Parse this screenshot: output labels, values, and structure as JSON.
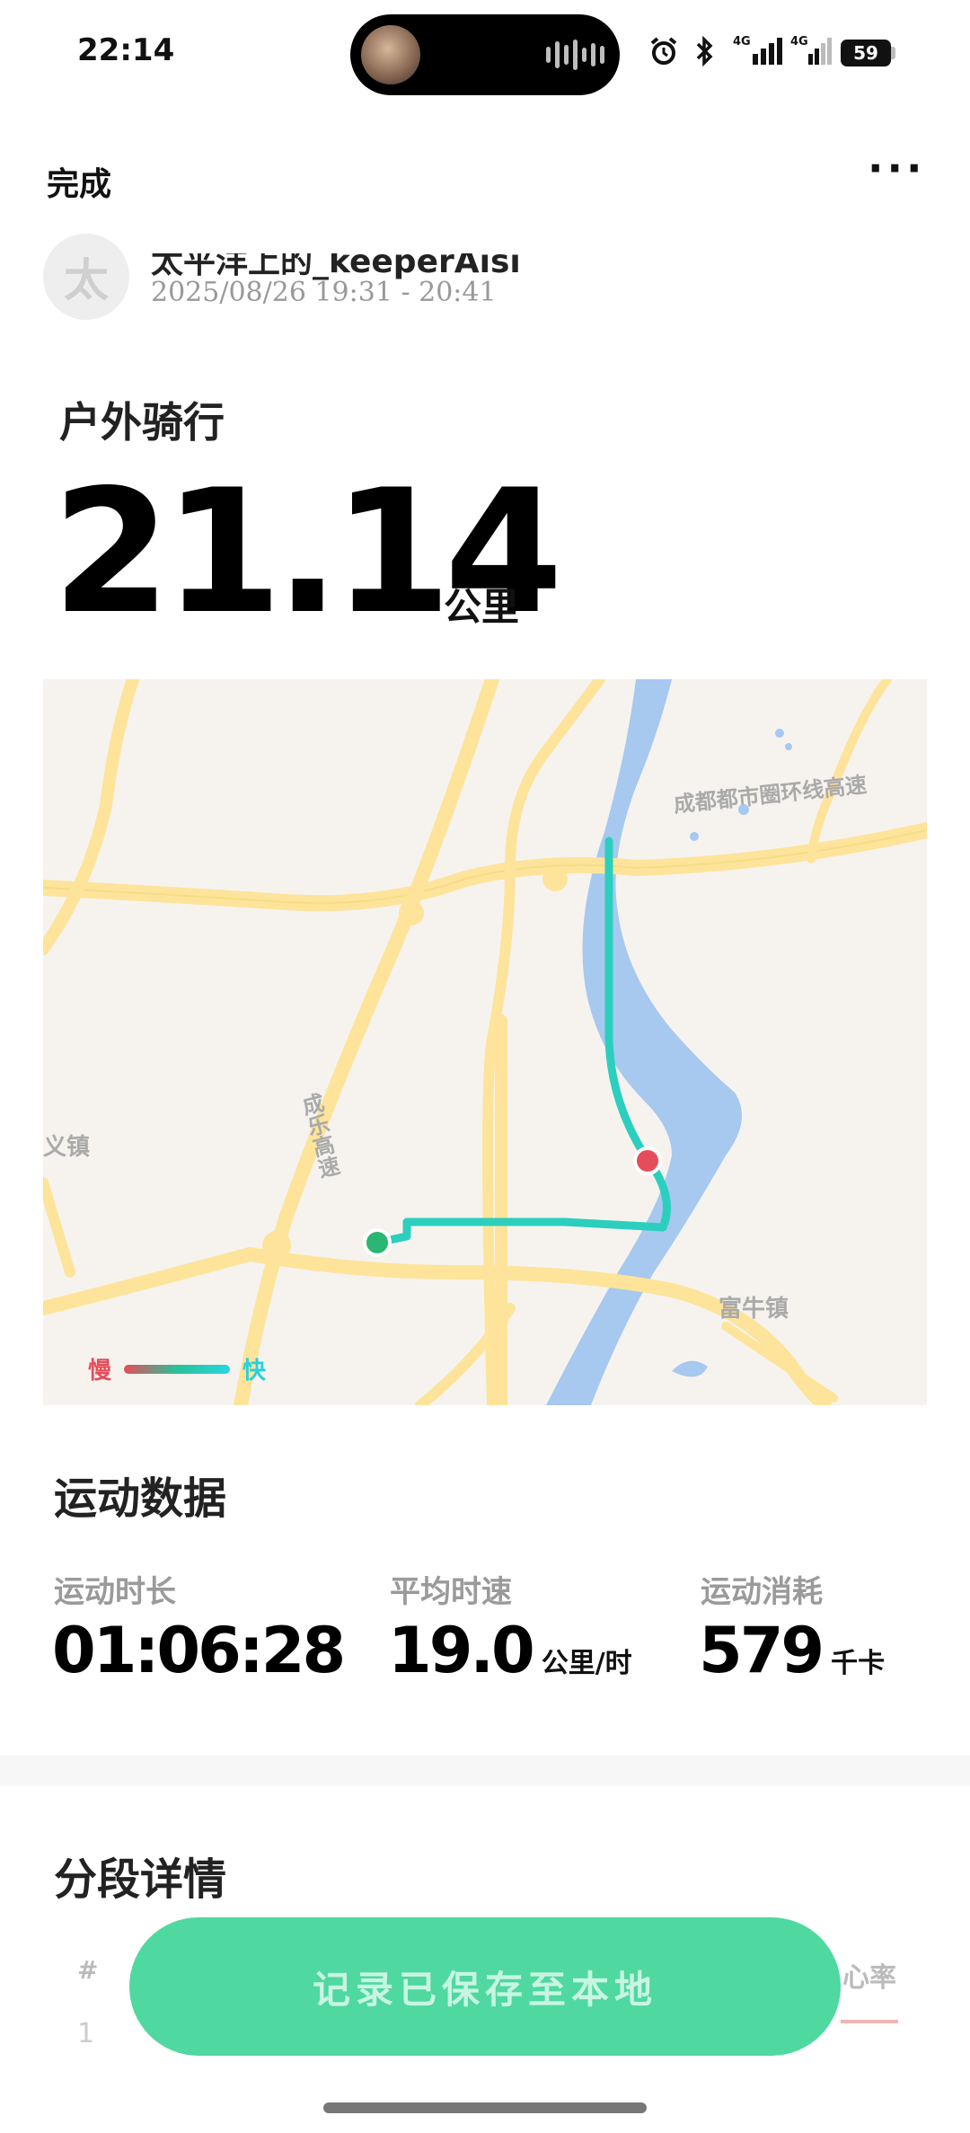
{
  "status_bar": {
    "time": "22:14",
    "network_1": "4G",
    "network_2": "4G",
    "battery": "59"
  },
  "header": {
    "done_label": "完成",
    "more_label": "···"
  },
  "user": {
    "avatar_char": "太",
    "name": "太平洋上的_keeperAisi",
    "time_range": "2025/08/26 19:31 - 20:41"
  },
  "activity": {
    "title": "户外骑行",
    "distance": "21.14",
    "distance_unit": "公里"
  },
  "map": {
    "labels": {
      "highway_east": "成都都市圈环线高速",
      "highway_west": "成乐高速",
      "town_west": "义镇",
      "town_east": "富牛镇"
    },
    "legend_slow": "慢",
    "legend_fast": "快",
    "colors": {
      "water": "#a7c8ef",
      "road": "#fde49a",
      "route": "#2ccfbe",
      "start": "#2bb673",
      "end": "#e64d5a"
    }
  },
  "sports_data": {
    "title": "运动数据",
    "duration_label": "运动时长",
    "duration_value": "01:06:28",
    "speed_label": "平均时速",
    "speed_value": "19.0",
    "speed_unit": "公里/时",
    "calories_label": "运动消耗",
    "calories_value": "579",
    "calories_unit": "千卡"
  },
  "segments": {
    "title": "分段详情",
    "col_index": "#",
    "col_heart_rate": "心率",
    "row_1_index": "1"
  },
  "toast": {
    "text": "记录已保存至本地"
  }
}
